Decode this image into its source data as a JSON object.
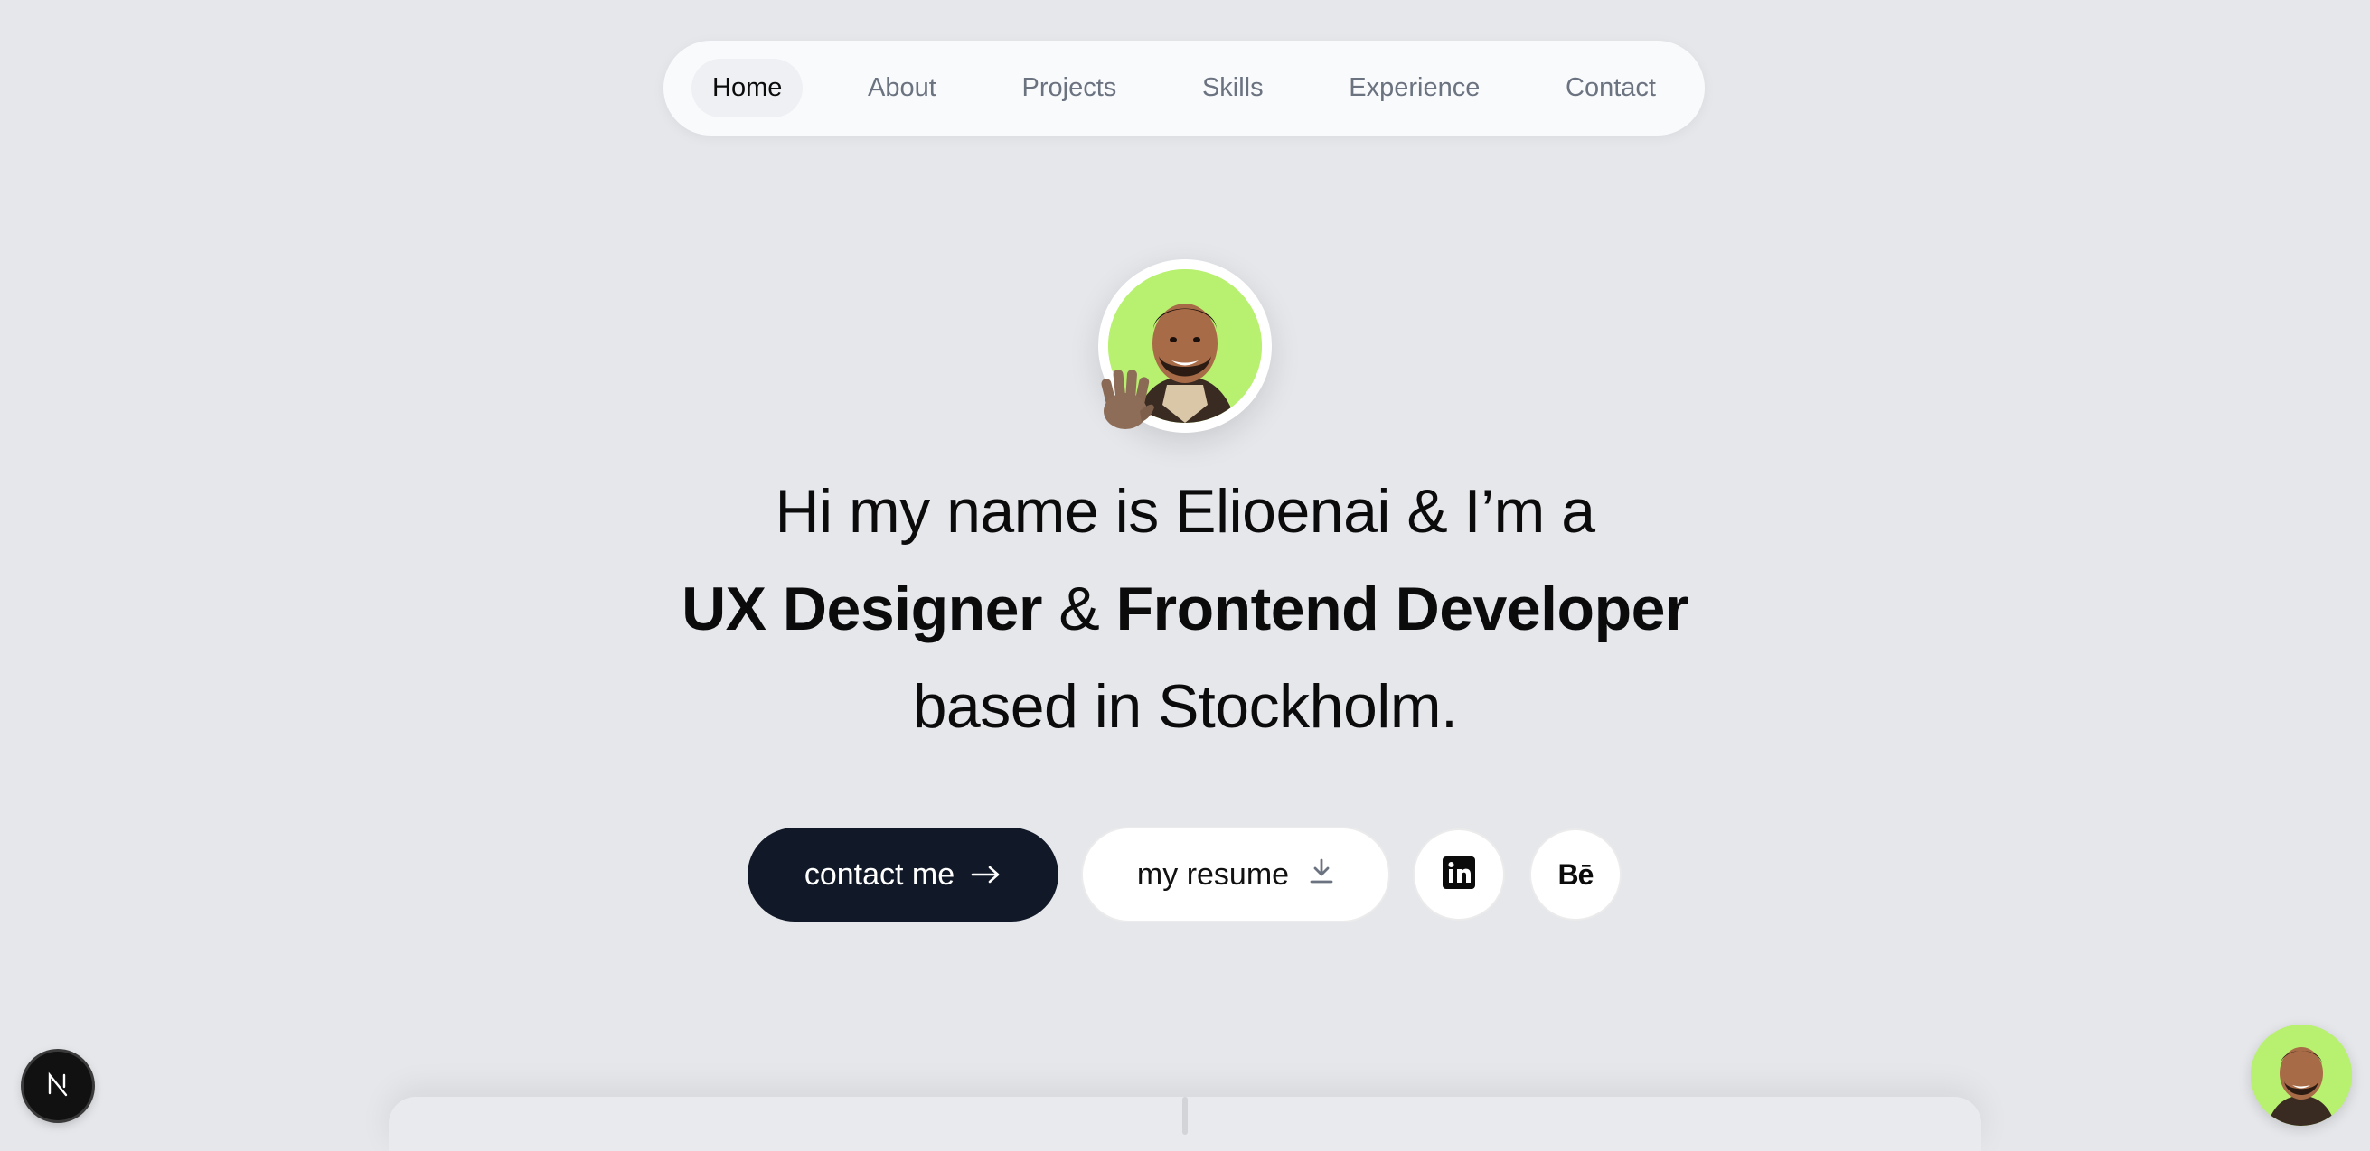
{
  "nav": {
    "items": [
      {
        "label": "Home",
        "active": true
      },
      {
        "label": "About",
        "active": false
      },
      {
        "label": "Projects",
        "active": false
      },
      {
        "label": "Skills",
        "active": false
      },
      {
        "label": "Experience",
        "active": false
      },
      {
        "label": "Contact",
        "active": false
      }
    ]
  },
  "hero": {
    "avatar_icon": "waving-hand-icon",
    "line1": "Hi my name is Elioenai & I’m a",
    "line2_role1": "UX Designer",
    "line2_amp": " & ",
    "line2_role2": "Frontend Developer",
    "line3": "based in Stockholm."
  },
  "actions": {
    "contact_label": "contact me",
    "contact_icon": "arrow-right-icon",
    "resume_label": "my resume",
    "resume_icon": "download-icon",
    "linkedin_icon": "linkedin-icon",
    "behance_label": "Bē",
    "behance_icon": "behance-icon"
  },
  "colors": {
    "background": "#e5e7eb",
    "primary_button": "#111827",
    "avatar_bg": "#b8f06f"
  }
}
